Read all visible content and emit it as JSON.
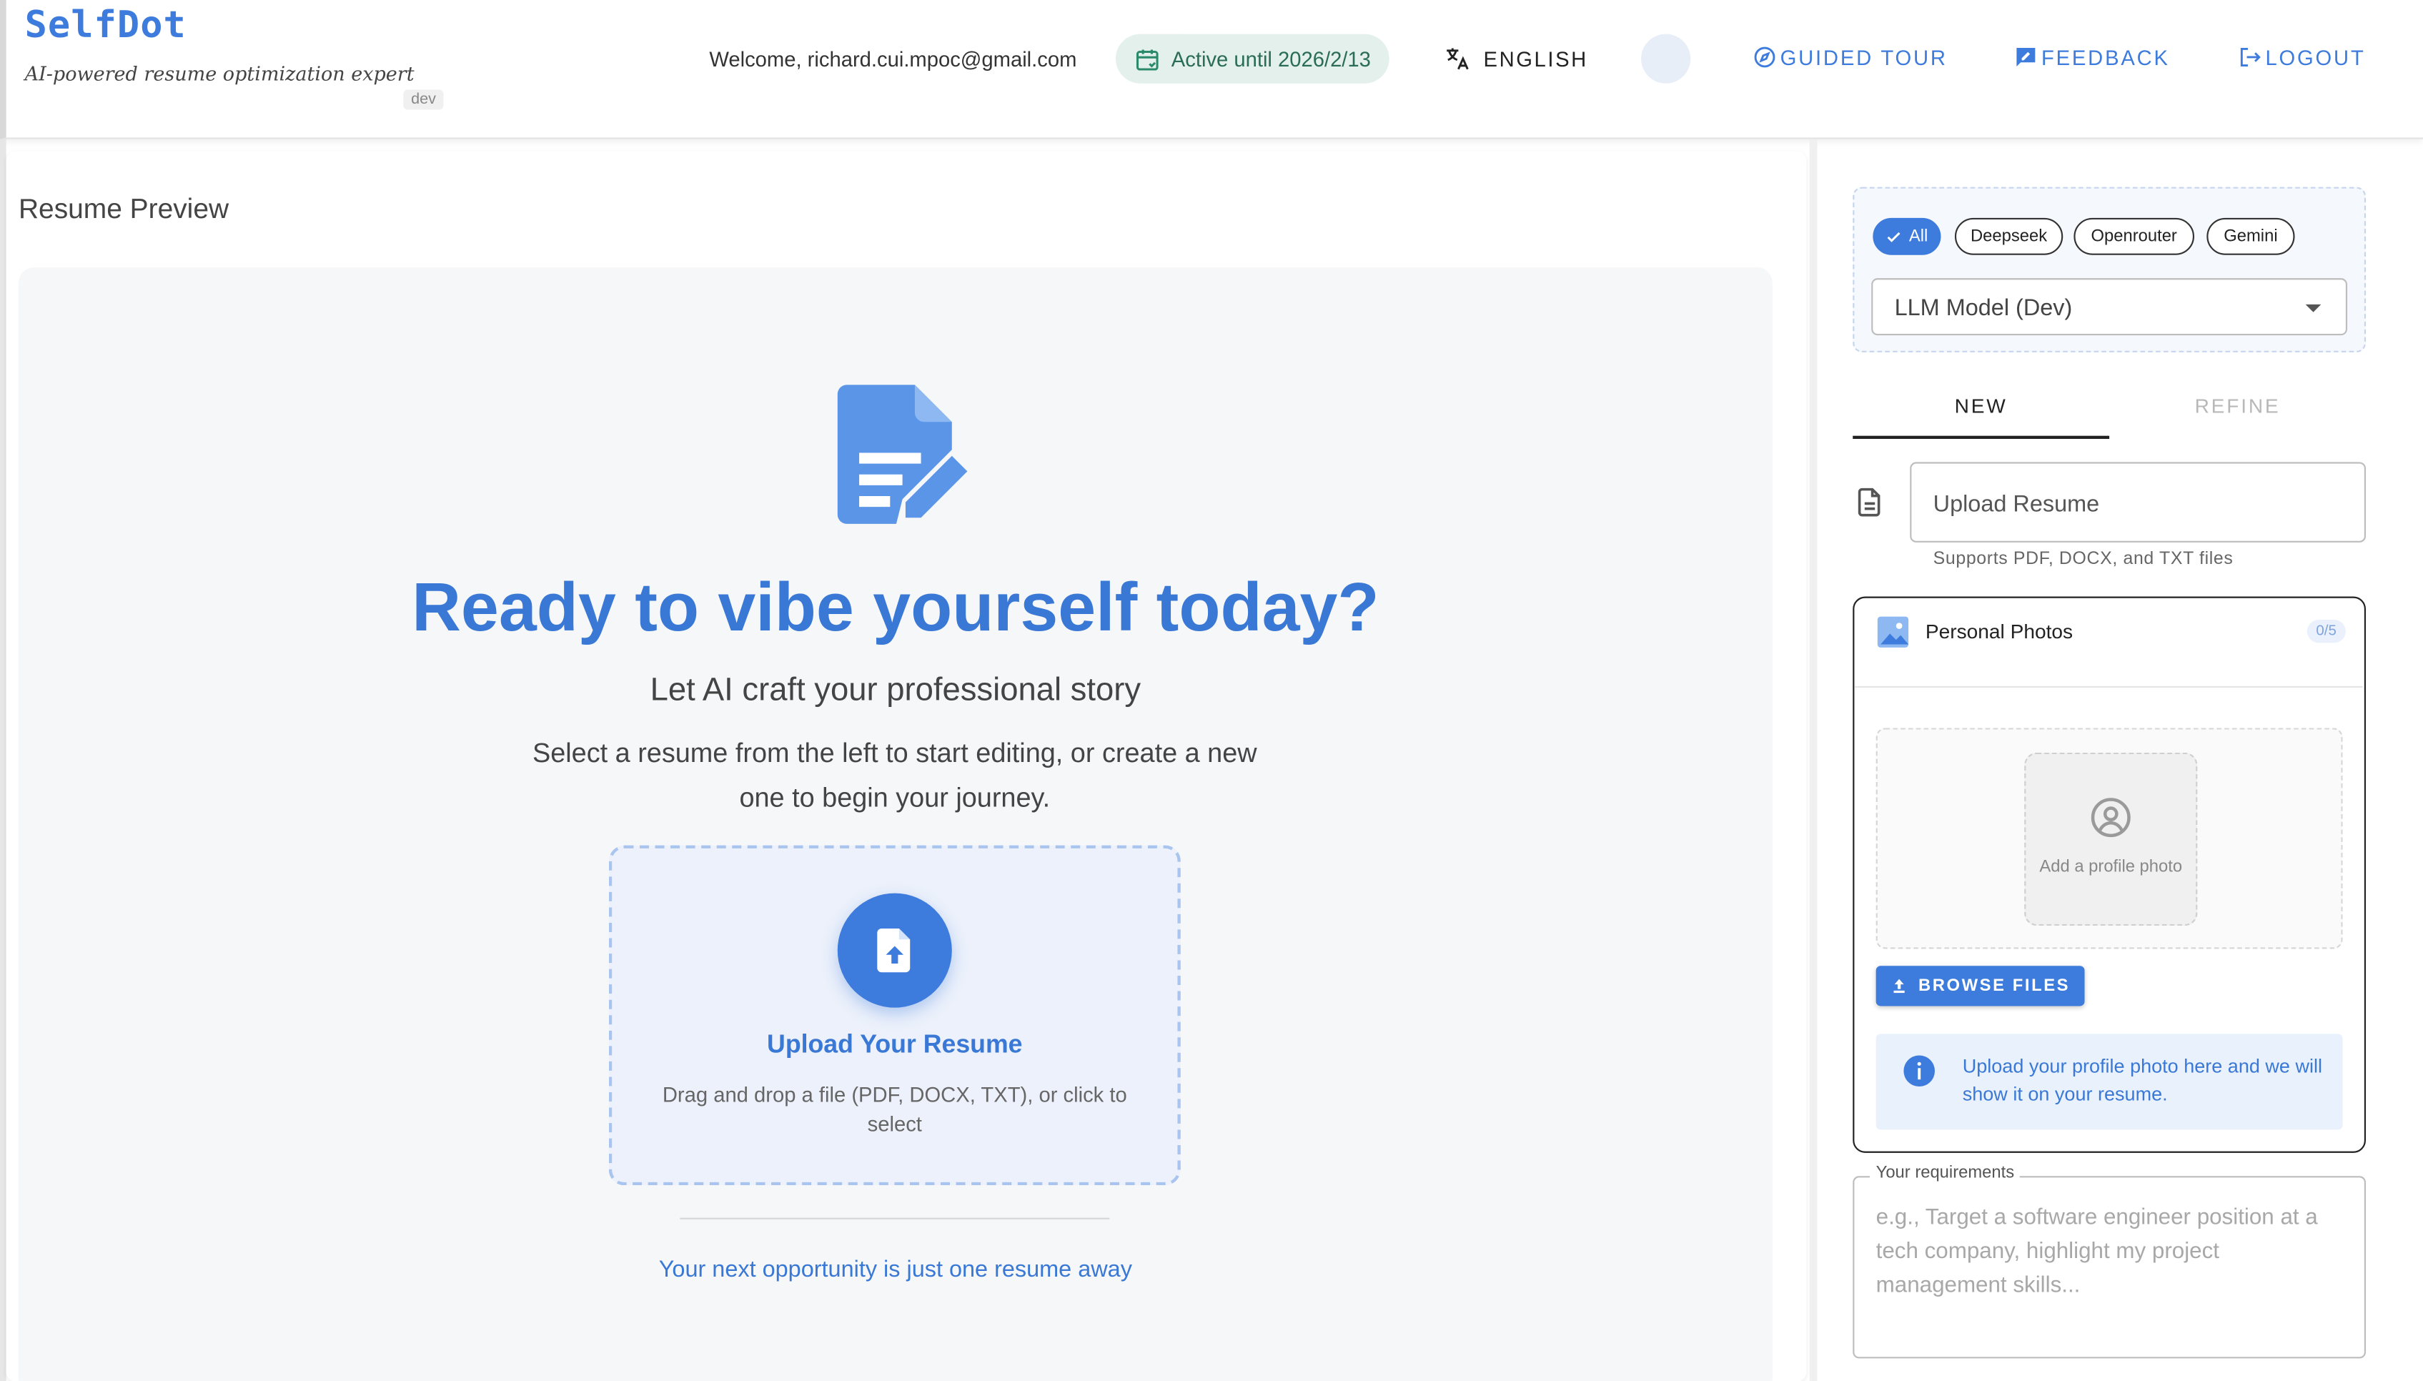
{
  "header": {
    "logo": "SelfDot",
    "tagline": "AI-powered resume optimization expert",
    "env_badge": "dev",
    "welcome": "Welcome, richard.cui.mpoc@gmail.com",
    "active_status": "Active until 2026/2/13",
    "language_label": "ENGLISH",
    "guided_tour_label": "GUIDED TOUR",
    "feedback_label": "FEEDBACK",
    "logout_label": "LOGOUT"
  },
  "preview": {
    "title": "Resume Preview",
    "hero_title": "Ready to vibe yourself today?",
    "hero_subtitle": "Let AI craft your professional story",
    "hero_description": "Select a resume from the left to start editing, or create a new one to begin your journey.",
    "upload_title": "Upload Your Resume",
    "upload_description": "Drag and drop a file (PDF, DOCX, TXT), or click to select",
    "footer_tagline": "Your next opportunity is just one resume away"
  },
  "sidebar": {
    "provider_chips": [
      {
        "label": "All",
        "selected": true
      },
      {
        "label": "Deepseek",
        "selected": false
      },
      {
        "label": "Openrouter",
        "selected": false
      },
      {
        "label": "Gemini",
        "selected": false
      }
    ],
    "model_select": "LLM Model (Dev)",
    "tabs": [
      {
        "label": "NEW",
        "active": true
      },
      {
        "label": "REFINE",
        "active": false
      }
    ],
    "upload_field_label": "Upload Resume",
    "upload_help": "Supports PDF, DOCX, and TXT files",
    "photos": {
      "title": "Personal Photos",
      "count": "0/5",
      "add_photo_label": "Add a profile photo",
      "browse_label": "BROWSE FILES",
      "info_text": "Upload your profile photo here and we will show it on your resume."
    },
    "requirements": {
      "label": "Your requirements",
      "placeholder": "e.g., Target a software engineer position at a tech company, highlight my project management skills..."
    }
  },
  "colors": {
    "accent": "#3d7bdc",
    "heading": "#3a78d6",
    "active_chip_bg": "#e3f0ec",
    "active_chip_text": "#2a6c56",
    "info_bg": "#e9f1fc"
  },
  "icons": [
    "calendar-check-icon",
    "translate-icon",
    "moon-icon",
    "compass-icon",
    "feedback-icon",
    "logout-icon",
    "resume-edit-icon",
    "file-upload-icon",
    "check-icon",
    "file-text-icon",
    "image-icon",
    "user-circle-icon",
    "upload-icon",
    "info-icon"
  ]
}
